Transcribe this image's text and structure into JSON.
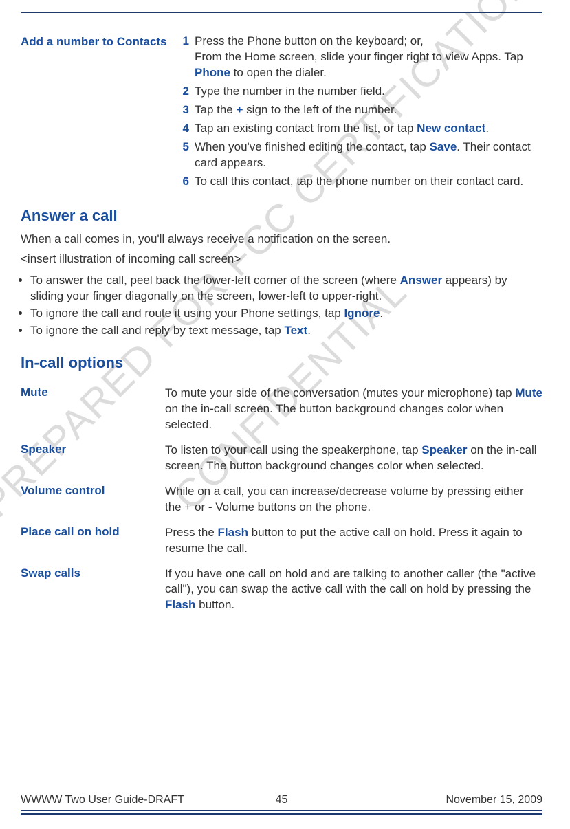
{
  "watermarks": {
    "prepared": "PREPARED FOR FCC CERTIFICATION",
    "confidential": "CONFIDENTIAL"
  },
  "addNumber": {
    "label": "Add a number to Contacts",
    "steps": [
      {
        "n": "1",
        "parts": [
          {
            "t": "Press the Phone button on the keyboard; or,"
          },
          {
            "t": "From the Home screen, slide your finger right to view Apps. Tap "
          },
          {
            "b": "Phone"
          },
          {
            "t": " to open the dialer."
          }
        ]
      },
      {
        "n": "2",
        "parts": [
          {
            "t": "Type the number in the number field."
          }
        ]
      },
      {
        "n": "3",
        "parts": [
          {
            "t": "Tap the "
          },
          {
            "b": "+"
          },
          {
            "t": " sign to the left of the number."
          }
        ]
      },
      {
        "n": "4",
        "parts": [
          {
            "t": "Tap an existing contact from the list, or tap "
          },
          {
            "b": "New contact"
          },
          {
            "t": "."
          }
        ]
      },
      {
        "n": "5",
        "parts": [
          {
            "t": "When you've finished editing the contact, tap "
          },
          {
            "b": "Save"
          },
          {
            "t": ". Their contact card appears."
          }
        ]
      },
      {
        "n": "6",
        "parts": [
          {
            "t": "To call this contact, tap the phone number on their contact card."
          }
        ]
      }
    ]
  },
  "answer": {
    "title": "Answer a call",
    "intro": "When a call comes in, you'll always receive a notification on the screen.",
    "placeholder": "<insert illustration of incoming call screen>",
    "bullets": [
      [
        {
          "t": "To answer the call, peel back the lower-left corner of the screen (where "
        },
        {
          "b": "Answer"
        },
        {
          "t": " appears) by sliding your finger diagonally on the screen, lower-left to upper-right."
        }
      ],
      [
        {
          "t": "To ignore the call and route it using your Phone settings, tap "
        },
        {
          "b": "Ignore"
        },
        {
          "t": "."
        }
      ],
      [
        {
          "t": "To ignore the call and reply by text message, tap "
        },
        {
          "b": "Text"
        },
        {
          "t": "."
        }
      ]
    ]
  },
  "incall": {
    "title": "In-call options",
    "rows": [
      {
        "label": "Mute",
        "parts": [
          {
            "t": "To mute your side of the conversation (mutes your microphone) tap "
          },
          {
            "b": "Mute"
          },
          {
            "t": " on the in-call screen. The button background changes color when selected."
          }
        ]
      },
      {
        "label": "Speaker",
        "parts": [
          {
            "t": "To listen to your call using the speakerphone, tap "
          },
          {
            "b": "Speaker"
          },
          {
            "t": " on the in-call screen. The button background changes color when selected."
          }
        ]
      },
      {
        "label": "Volume control",
        "parts": [
          {
            "t": "While on a call, you can increase/decrease volume by pressing either the + or - Volume buttons on the phone."
          }
        ]
      },
      {
        "label": "Place call on hold",
        "parts": [
          {
            "t": "Press the "
          },
          {
            "b": "Flash"
          },
          {
            "t": " button to put the active call on hold. Press it again to resume the call."
          }
        ]
      },
      {
        "label": "Swap calls",
        "parts": [
          {
            "t": "If you have one call on hold and are talking to another caller (the \"active call\"), you can swap the active call with the call on hold by pressing the "
          },
          {
            "b": "Flash"
          },
          {
            "t": " button."
          }
        ]
      }
    ]
  },
  "footer": {
    "left": "WWWW Two User Guide-DRAFT",
    "page": "45",
    "right": "November 15, 2009"
  }
}
